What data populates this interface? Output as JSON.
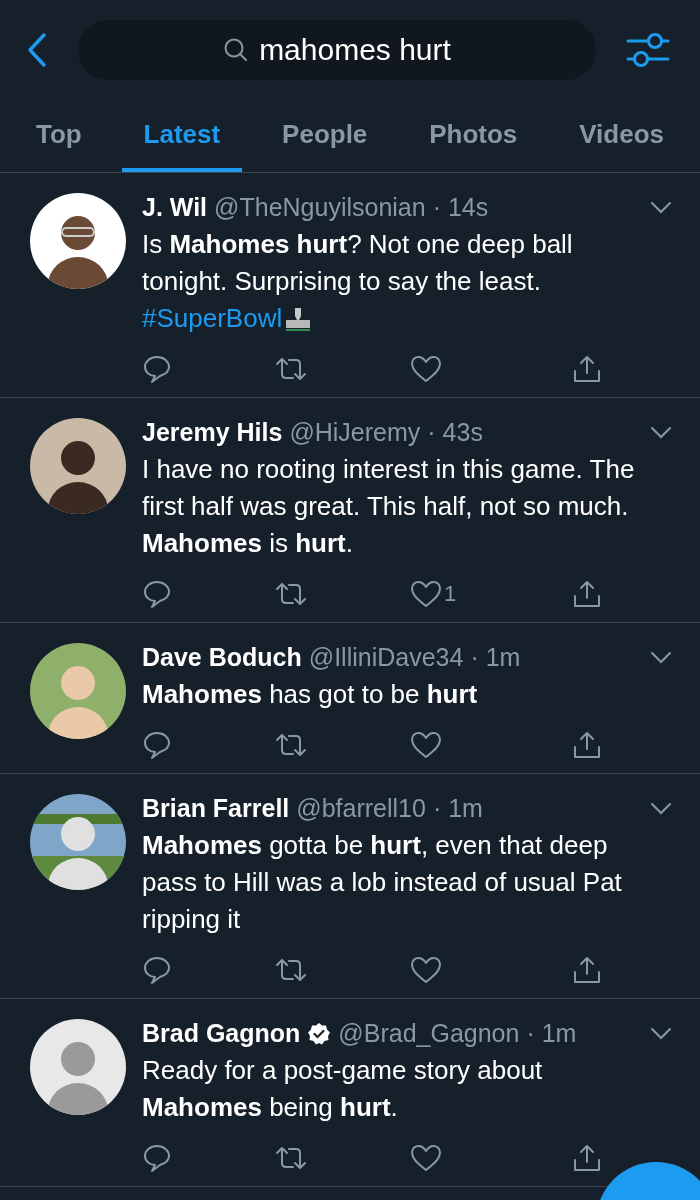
{
  "search": {
    "value": "mahomes hurt"
  },
  "tabs": [
    {
      "label": "Top",
      "selected": false
    },
    {
      "label": "Latest",
      "selected": true
    },
    {
      "label": "People",
      "selected": false
    },
    {
      "label": "Photos",
      "selected": false
    },
    {
      "label": "Videos",
      "selected": false
    }
  ],
  "tweets": [
    {
      "name": "J. Wil",
      "verified": false,
      "handle": "@TheNguyilsonian",
      "time": "· 14s",
      "text": "Is **Mahomes hurt**? Not one deep ball tonight. Surprising to say the least.",
      "hashtag": "#SuperBowl"
    },
    {
      "name": "Jeremy Hils",
      "verified": false,
      "handle": "@HiJeremy",
      "time": "· 43s",
      "text": "I have no rooting interest in this game. The first half was great. This half, not so much. **Mahomes** is **hurt**.",
      "like_count": "1"
    },
    {
      "name": "Dave Boduch",
      "verified": false,
      "handle": "@IlliniDave34",
      "time": "· 1m",
      "text": "**Mahomes** has got to be **hurt**"
    },
    {
      "name": "Brian Farrell",
      "verified": false,
      "handle": "@bfarrell10",
      "time": "· 1m",
      "text": "**Mahomes** gotta be **hurt**, even that deep pass to Hill was a lob instead of usual Pat ripping it"
    },
    {
      "name": "Brad Gagnon",
      "verified": true,
      "handle": "@Brad_Gagnon",
      "time": "· 1m",
      "text": "Ready for a post-game story about **Mahomes** being **hurt**."
    }
  ]
}
